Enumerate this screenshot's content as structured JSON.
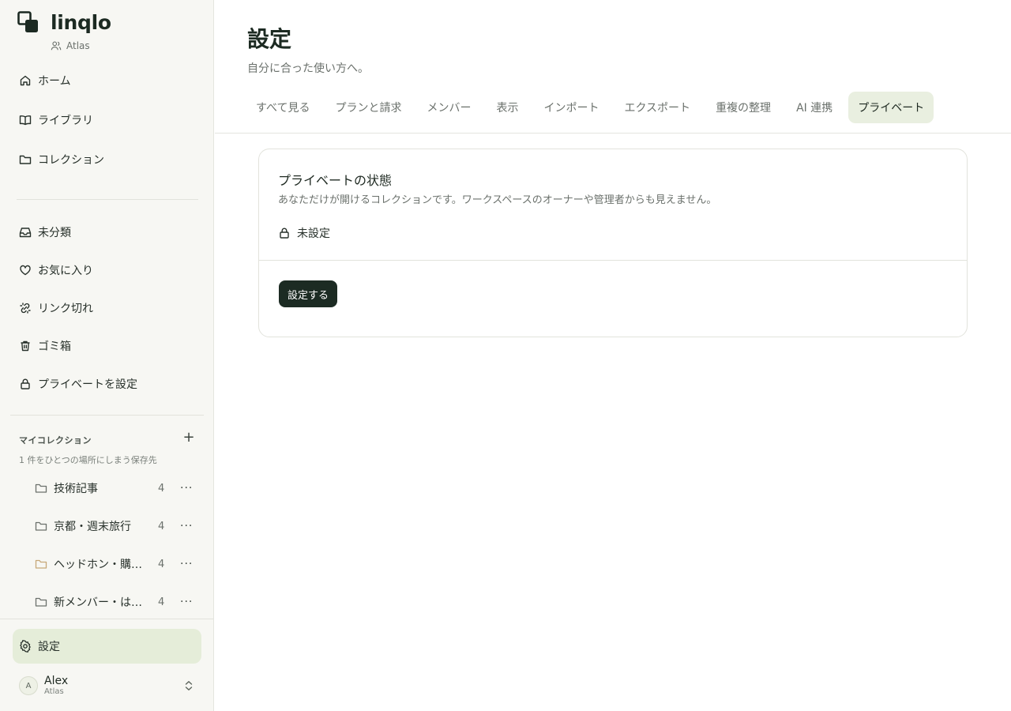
{
  "app": {
    "name": "linqlo",
    "workspace": "Atlas"
  },
  "sidebar": {
    "primary": [
      {
        "label": "ホーム",
        "icon": "home-icon"
      },
      {
        "label": "ライブラリ",
        "icon": "book-icon"
      },
      {
        "label": "コレクション",
        "icon": "folder-icon"
      }
    ],
    "secondary": [
      {
        "label": "未分類",
        "icon": "inbox-icon"
      },
      {
        "label": "お気に入り",
        "icon": "heart-icon"
      },
      {
        "label": "リンク切れ",
        "icon": "broken-link-icon"
      },
      {
        "label": "ゴミ箱",
        "icon": "trash-icon"
      },
      {
        "label": "プライベートを設定",
        "icon": "lock-icon"
      }
    ],
    "collections": {
      "heading": "マイコレクション",
      "add_symbol": "+",
      "subtitle": "1 件をひとつの場所にしまう保存先",
      "items": [
        {
          "name": "技術記事",
          "count": "4"
        },
        {
          "name": "京都・週末旅行",
          "count": "4"
        },
        {
          "name": "ヘッドホン・購入比較",
          "count": "4"
        },
        {
          "name": "新メンバー・はじめに",
          "count": "4"
        }
      ],
      "more_symbol": "···"
    },
    "settings_label": "設定",
    "user": {
      "initial": "A",
      "name": "Alex",
      "workspace": "Atlas"
    }
  },
  "main": {
    "title": "設定",
    "subtitle": "自分に合った使い方へ。",
    "tabs": [
      {
        "label": "すべて見る"
      },
      {
        "label": "プランと請求"
      },
      {
        "label": "メンバー"
      },
      {
        "label": "表示"
      },
      {
        "label": "インポート"
      },
      {
        "label": "エクスポート"
      },
      {
        "label": "重複の整理"
      },
      {
        "label": "AI 連携"
      },
      {
        "label": "プライベート",
        "active": true
      }
    ],
    "card": {
      "title": "プライベートの状態",
      "description": "あなただけが開けるコレクションです。ワークスペースのオーナーや管理者からも見えません。",
      "status": "未設定",
      "button": "設定する"
    }
  },
  "colors": {
    "accent_dark": "#1c2b23",
    "active_bg": "#e5edd9",
    "sidebar_bg": "#f7f7f3",
    "border": "#e2e3dc",
    "logo_folder": "#c7a878"
  }
}
